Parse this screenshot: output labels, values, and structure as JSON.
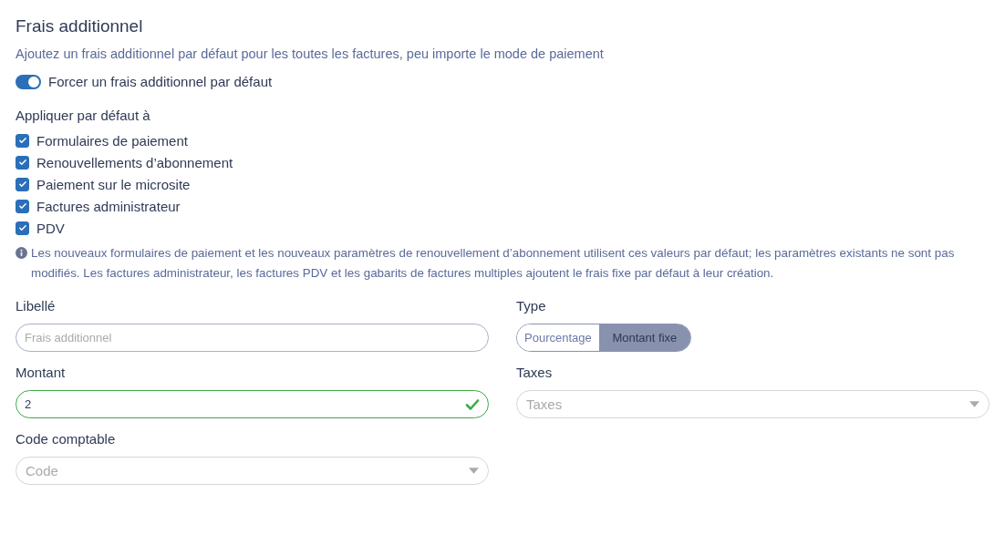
{
  "title": "Frais additionnel",
  "subtitle": "Ajoutez un frais additionnel par défaut pour les toutes les factures, peu importe le mode de paiement",
  "force_toggle": {
    "label": "Forcer un frais additionnel par défaut",
    "on": true
  },
  "apply_heading": "Appliquer par défaut à",
  "apply_options": [
    {
      "label": "Formulaires de paiement",
      "checked": true
    },
    {
      "label": "Renouvellements d’abonnement",
      "checked": true
    },
    {
      "label": "Paiement sur le microsite",
      "checked": true
    },
    {
      "label": "Factures administrateur",
      "checked": true
    },
    {
      "label": "PDV",
      "checked": true
    }
  ],
  "note": "Les nouveaux formulaires de paiement et les nouveaux paramètres de renouvellement d’abonnement utilisent ces valeurs par défaut; les paramètres existants ne sont pas modifiés. Les factures administrateur, les factures PDV et les gabarits de factures multiples ajoutent le frais fixe par défaut à leur création.",
  "libelle": {
    "label": "Libellé",
    "placeholder": "Frais additionnel"
  },
  "type": {
    "label": "Type",
    "options": [
      {
        "label": "Pourcentage",
        "selected": false
      },
      {
        "label": "Montant fixe",
        "selected": true
      }
    ]
  },
  "montant": {
    "label": "Montant",
    "value": "2",
    "valid": true
  },
  "taxes": {
    "label": "Taxes",
    "placeholder": "Taxes"
  },
  "code": {
    "label": "Code comptable",
    "placeholder": "Code"
  }
}
